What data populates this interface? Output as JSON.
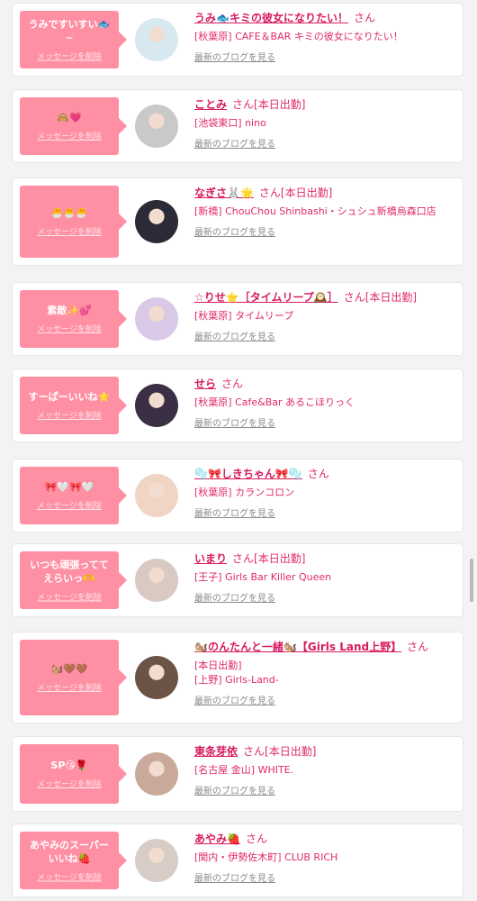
{
  "delete_label": "メッセージを削除",
  "blog_label": "最新のブログを見る",
  "suffix_label": "さん",
  "entries": [
    {
      "message": "うみですいすい🐟~",
      "name": "うみ🐟キミの彼女になりたい！",
      "status": "",
      "area": "[秋葉原] CAFE＆BAR キミの彼女になりたい！",
      "area2": ""
    },
    {
      "message": "🙈💗",
      "name": "ことみ",
      "status": "[本日出勤]",
      "area": "[池袋東口] nino",
      "area2": ""
    },
    {
      "message": "🐣🐣🐣",
      "name": "なぎさ🐰🌟",
      "status": "[本日出勤]",
      "area": "[新橋] ChouChou Shinbashi・シュシュ新橋烏森口店",
      "area2": ""
    },
    {
      "message": "素敵✨💕",
      "name": "☆りせ⭐［タイムリープ🕰️］",
      "status": "[本日出勤]",
      "area": "[秋葉原] タイムリープ",
      "area2": ""
    },
    {
      "message": "すーぱーいいね⭐",
      "name": "せら",
      "status": "",
      "area": "[秋葉原] Cafe&Bar あるこほりっく",
      "area2": ""
    },
    {
      "message": "🎀🤍🎀🤍",
      "name": "🫧🎀しきちゃん🎀🫧",
      "status": "",
      "area": "[秋葉原] カランコロン",
      "area2": ""
    },
    {
      "message": "いつも頑張っててえらいっ🫶",
      "name": "いまり",
      "status": "[本日出勤]",
      "area": "[王子] Girls Bar Killer Queen",
      "area2": ""
    },
    {
      "message": "🐿️🤎🤎",
      "name": "🐿️のんたんと一緒🐿️【Girls Land上野】",
      "status": "",
      "area": "[本日出勤]",
      "area2": "[上野] Girls-Land-"
    },
    {
      "message": "SP😘🌹",
      "name": "東条芽依",
      "status": "[本日出勤]",
      "area": "[名古屋 金山] WHITE.",
      "area2": ""
    },
    {
      "message": "あやみのスーパーいいね🍓",
      "name": "あやみ🍓",
      "status": "",
      "area": "[関内・伊勢佐木町] CLUB RICH",
      "area2": ""
    }
  ],
  "avatar_colors": [
    "#d7e8f0",
    "#c9c9c9",
    "#2b2b38",
    "#d9c8e6",
    "#3a2f45",
    "#f0d5c5",
    "#d8c9c2",
    "#6b5446",
    "#c8a99a",
    "#d7cdc6"
  ]
}
